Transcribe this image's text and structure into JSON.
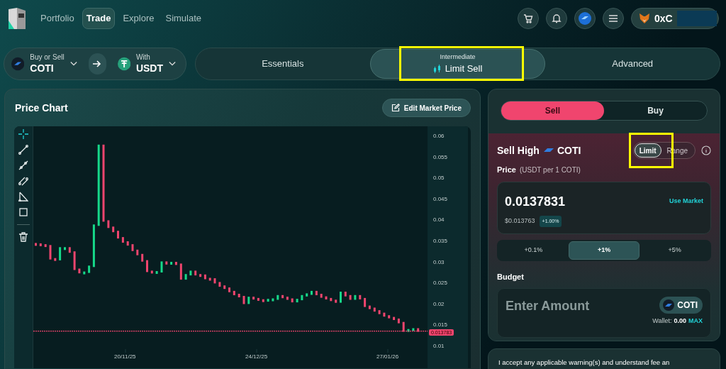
{
  "nav": {
    "items": [
      {
        "label": "Portfolio",
        "selected": false
      },
      {
        "label": "Trade",
        "selected": true
      },
      {
        "label": "Explore",
        "selected": false
      },
      {
        "label": "Simulate",
        "selected": false
      }
    ],
    "wallet": {
      "address": "0xC"
    }
  },
  "pair": {
    "base_caption": "Buy or Sell",
    "base": "COTI",
    "quote_caption": "With",
    "quote": "USDT"
  },
  "modes": [
    {
      "label": "Essentials",
      "selected": false
    },
    {
      "caption": "Intermediate",
      "label": "Limit Sell",
      "selected": true
    },
    {
      "label": "Advanced",
      "selected": false
    }
  ],
  "chart_panel": {
    "title": "Price Chart",
    "edit_button": "Edit Market Price",
    "tools": [
      {
        "kind": "crosshair",
        "selected": true
      },
      {
        "kind": "line",
        "selected": false
      },
      {
        "kind": "ray",
        "selected": false
      },
      {
        "kind": "parallel",
        "selected": false
      },
      {
        "kind": "angle",
        "selected": false
      },
      {
        "kind": "rect",
        "selected": false
      },
      {
        "kind": "trash",
        "selected": false
      }
    ],
    "yticks": [
      "0.06",
      "0.055",
      "0.05",
      "0.045",
      "0.04",
      "0.035",
      "0.03",
      "0.025",
      "0.02",
      "0.015",
      "0.01"
    ],
    "xticks": [
      "20/11/25",
      "24/12/25",
      "27/01/26"
    ],
    "price_tag": "0.013783"
  },
  "order": {
    "sides": [
      {
        "label": "Sell",
        "selected": true
      },
      {
        "label": "Buy",
        "selected": false
      }
    ],
    "heading": "Sell High",
    "token": "COTI",
    "types": [
      {
        "label": "Limit",
        "selected": true
      },
      {
        "label": "Range",
        "selected": false
      }
    ],
    "price_label": "Price",
    "price_unit": "(USDT per 1 COTI)",
    "price": "0.0137831",
    "use_market": "Use Market",
    "usd_price": "$0.013763",
    "change": "+1.00%",
    "steps": [
      {
        "label": "+0.1%",
        "selected": false
      },
      {
        "label": "+1%",
        "selected": true
      },
      {
        "label": "+5%",
        "selected": false
      }
    ],
    "budget_label": "Budget",
    "amount_placeholder": "Enter Amount",
    "amount_token": "COTI",
    "wallet_label": "Wallet:",
    "wallet_balance": "0.00",
    "max": "MAX"
  },
  "disclaimer": "I accept any applicable warning(s) and understand fee an"
}
